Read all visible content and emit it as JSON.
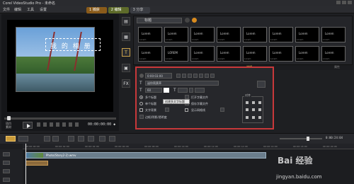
{
  "window": {
    "title": "Corel VideoStudio Pro - 未命名"
  },
  "menu": [
    "文件",
    "编辑",
    "工具",
    "设置"
  ],
  "steps": [
    {
      "label": "1 捕获"
    },
    {
      "label": "2 编辑"
    },
    {
      "label": "3 分享"
    }
  ],
  "player": {
    "overlay_title": "我 的 相 册",
    "mode_labels": [
      "项目",
      "素材"
    ],
    "timecode": "00:00:00:00 ◆"
  },
  "sidetools": [
    "▤",
    "▦",
    "T",
    "▣",
    "FX"
  ],
  "library": {
    "category": "标题",
    "thumbs": [
      "Lorem",
      "Lorem",
      "Lorem",
      "Lorem",
      "Lorem",
      "Lorem",
      "Lorem",
      "Lorem",
      "Lorem",
      "LOREM",
      "Lorem",
      "Lorem",
      "Lorem",
      "Lorem",
      "Lorem",
      "Lorem"
    ],
    "thumb_caption": "Lorem"
  },
  "panel": {
    "tab_edit": "编辑",
    "tab_attr": "属性"
  },
  "options": {
    "duration": "0:00:03:00",
    "font": "迷你简黄草",
    "font_size": "60",
    "single_title": "单个标题",
    "multi_title": "多个标题",
    "open_subtitle": "打开字幕文件",
    "save_subtitle": "保存字幕文件",
    "text_bg": "文字背景",
    "show_grid": "显示网格线",
    "border_label": "边框/阴影/透明度",
    "tooltip": "创建多文字标题",
    "align_label": "对齐"
  },
  "timeline": {
    "end_time": "0:00:24:04",
    "ruler": [
      "00:00:00:00",
      "00:00:02:00",
      "00:00:04:00",
      "00:00:06:00",
      "00:00:08:00",
      "00:00:10:00",
      "00:00:12:00",
      "00:00:14:00",
      "00:00:16:00",
      "00:00:18:00",
      "00:00:20:00"
    ],
    "clip_label": "Photo(Story2-2).wmv"
  },
  "watermark": {
    "brand": "Bai 经验",
    "url": "jingyan.baidu.com"
  }
}
